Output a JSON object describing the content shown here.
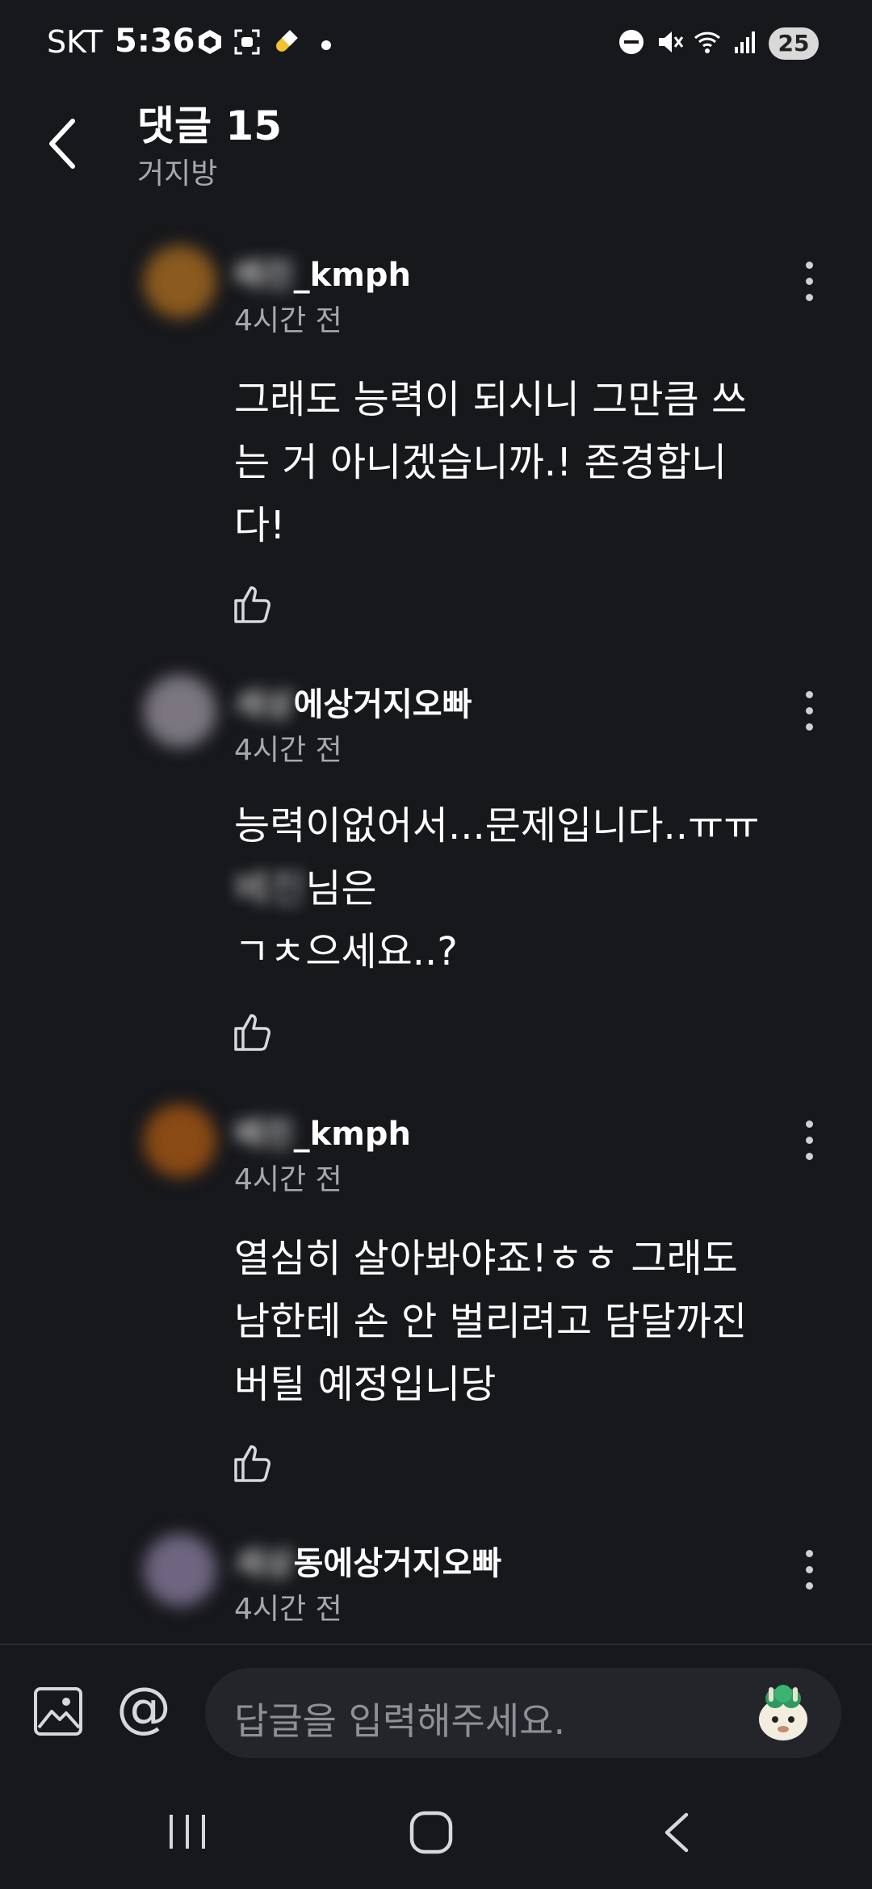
{
  "status_bar": {
    "carrier": "SKT",
    "time": "5:36",
    "battery": "25"
  },
  "header": {
    "title": "댓글 15",
    "subtitle": "거지방"
  },
  "comments": [
    {
      "username_visible": "_kmph",
      "username_blurred": "베진",
      "time_ago": "4시간 전",
      "lines": [
        "그래도 능력이 되시니 그만큼 쓰",
        "는 거 아니겠습니까.! 존경합니",
        "다!"
      ],
      "avatar_color": "#8a5a1e"
    },
    {
      "username_visible": "에상거지오빠",
      "username_blurred": "세상",
      "time_ago": "4시간 전",
      "lines": [
        "능력이없어서...문제입니다..ㅠㅠ",
        "님은",
        "ㄱㅊ으세요..?"
      ],
      "blurred_prefix": "베진",
      "avatar_color": "#7b7680"
    },
    {
      "username_visible": "_kmph",
      "username_blurred": "베진",
      "time_ago": "4시간 전",
      "lines": [
        "열심히 살아봐야죠!ㅎㅎ 그래도",
        "남한테 손 안 벌리려고 담달까진",
        "버틸 예정입니당"
      ],
      "avatar_color": "#8a4a14"
    },
    {
      "username_visible": "동에상거지오빠",
      "username_blurred": "세상",
      "time_ago": "4시간 전",
      "lines": [],
      "avatar_color": "#6e6580"
    }
  ],
  "input_bar": {
    "placeholder": "답글을 입력해주세요.",
    "at_symbol": "@"
  },
  "colors": {
    "background": "#17181c",
    "secondary_text": "#a6a8ad",
    "input_bg": "#24252a"
  }
}
